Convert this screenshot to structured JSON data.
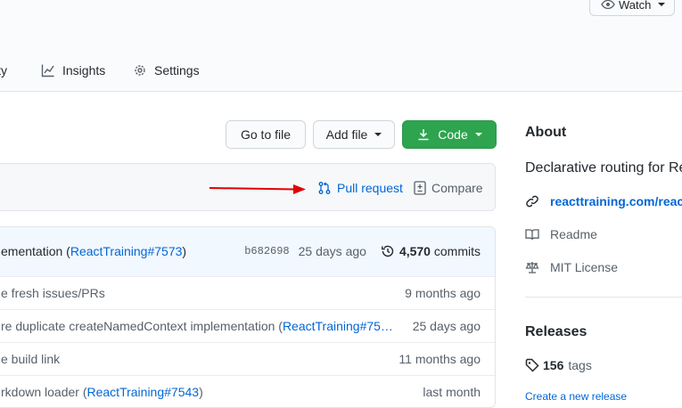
{
  "header": {
    "watch_label": "Watch",
    "tabs": [
      {
        "label": "ity"
      },
      {
        "label": "Insights"
      },
      {
        "label": "Settings"
      }
    ]
  },
  "toolbar": {
    "go_to_file": "Go to file",
    "add_file": "Add file",
    "code": "Code"
  },
  "branch_bar": {
    "pull_request": "Pull request",
    "compare": "Compare"
  },
  "latest_commit": {
    "message_prefix": "ementation (",
    "message_link": "ReactTraining#7573",
    "message_suffix": ")",
    "sha": "b682698",
    "ago": "25 days ago",
    "commit_count": "4,570",
    "commits_label": "commits"
  },
  "files": [
    {
      "msg": "e fresh issues/PRs",
      "link": "",
      "suffix": "",
      "time": "9 months ago"
    },
    {
      "msg": "re duplicate createNamedContext implementation (",
      "link": "ReactTraining#75…",
      "suffix": "",
      "time": "25 days ago"
    },
    {
      "msg": "e build link",
      "link": "",
      "suffix": "",
      "time": "11 months ago"
    },
    {
      "msg": "rkdown loader (",
      "link": "ReactTraining#7543",
      "suffix": ")",
      "time": "last month"
    }
  ],
  "about": {
    "heading": "About",
    "description": "Declarative routing for Re",
    "website": "reacttraining.com/react-",
    "readme": "Readme",
    "license": "MIT License"
  },
  "releases": {
    "heading": "Releases",
    "tag_count": "156",
    "tags_label": "tags",
    "create_release": "Create a new release"
  },
  "colors": {
    "link": "#0366d6",
    "green_button": "#2ea44f",
    "annotation_arrow": "#e00000"
  }
}
